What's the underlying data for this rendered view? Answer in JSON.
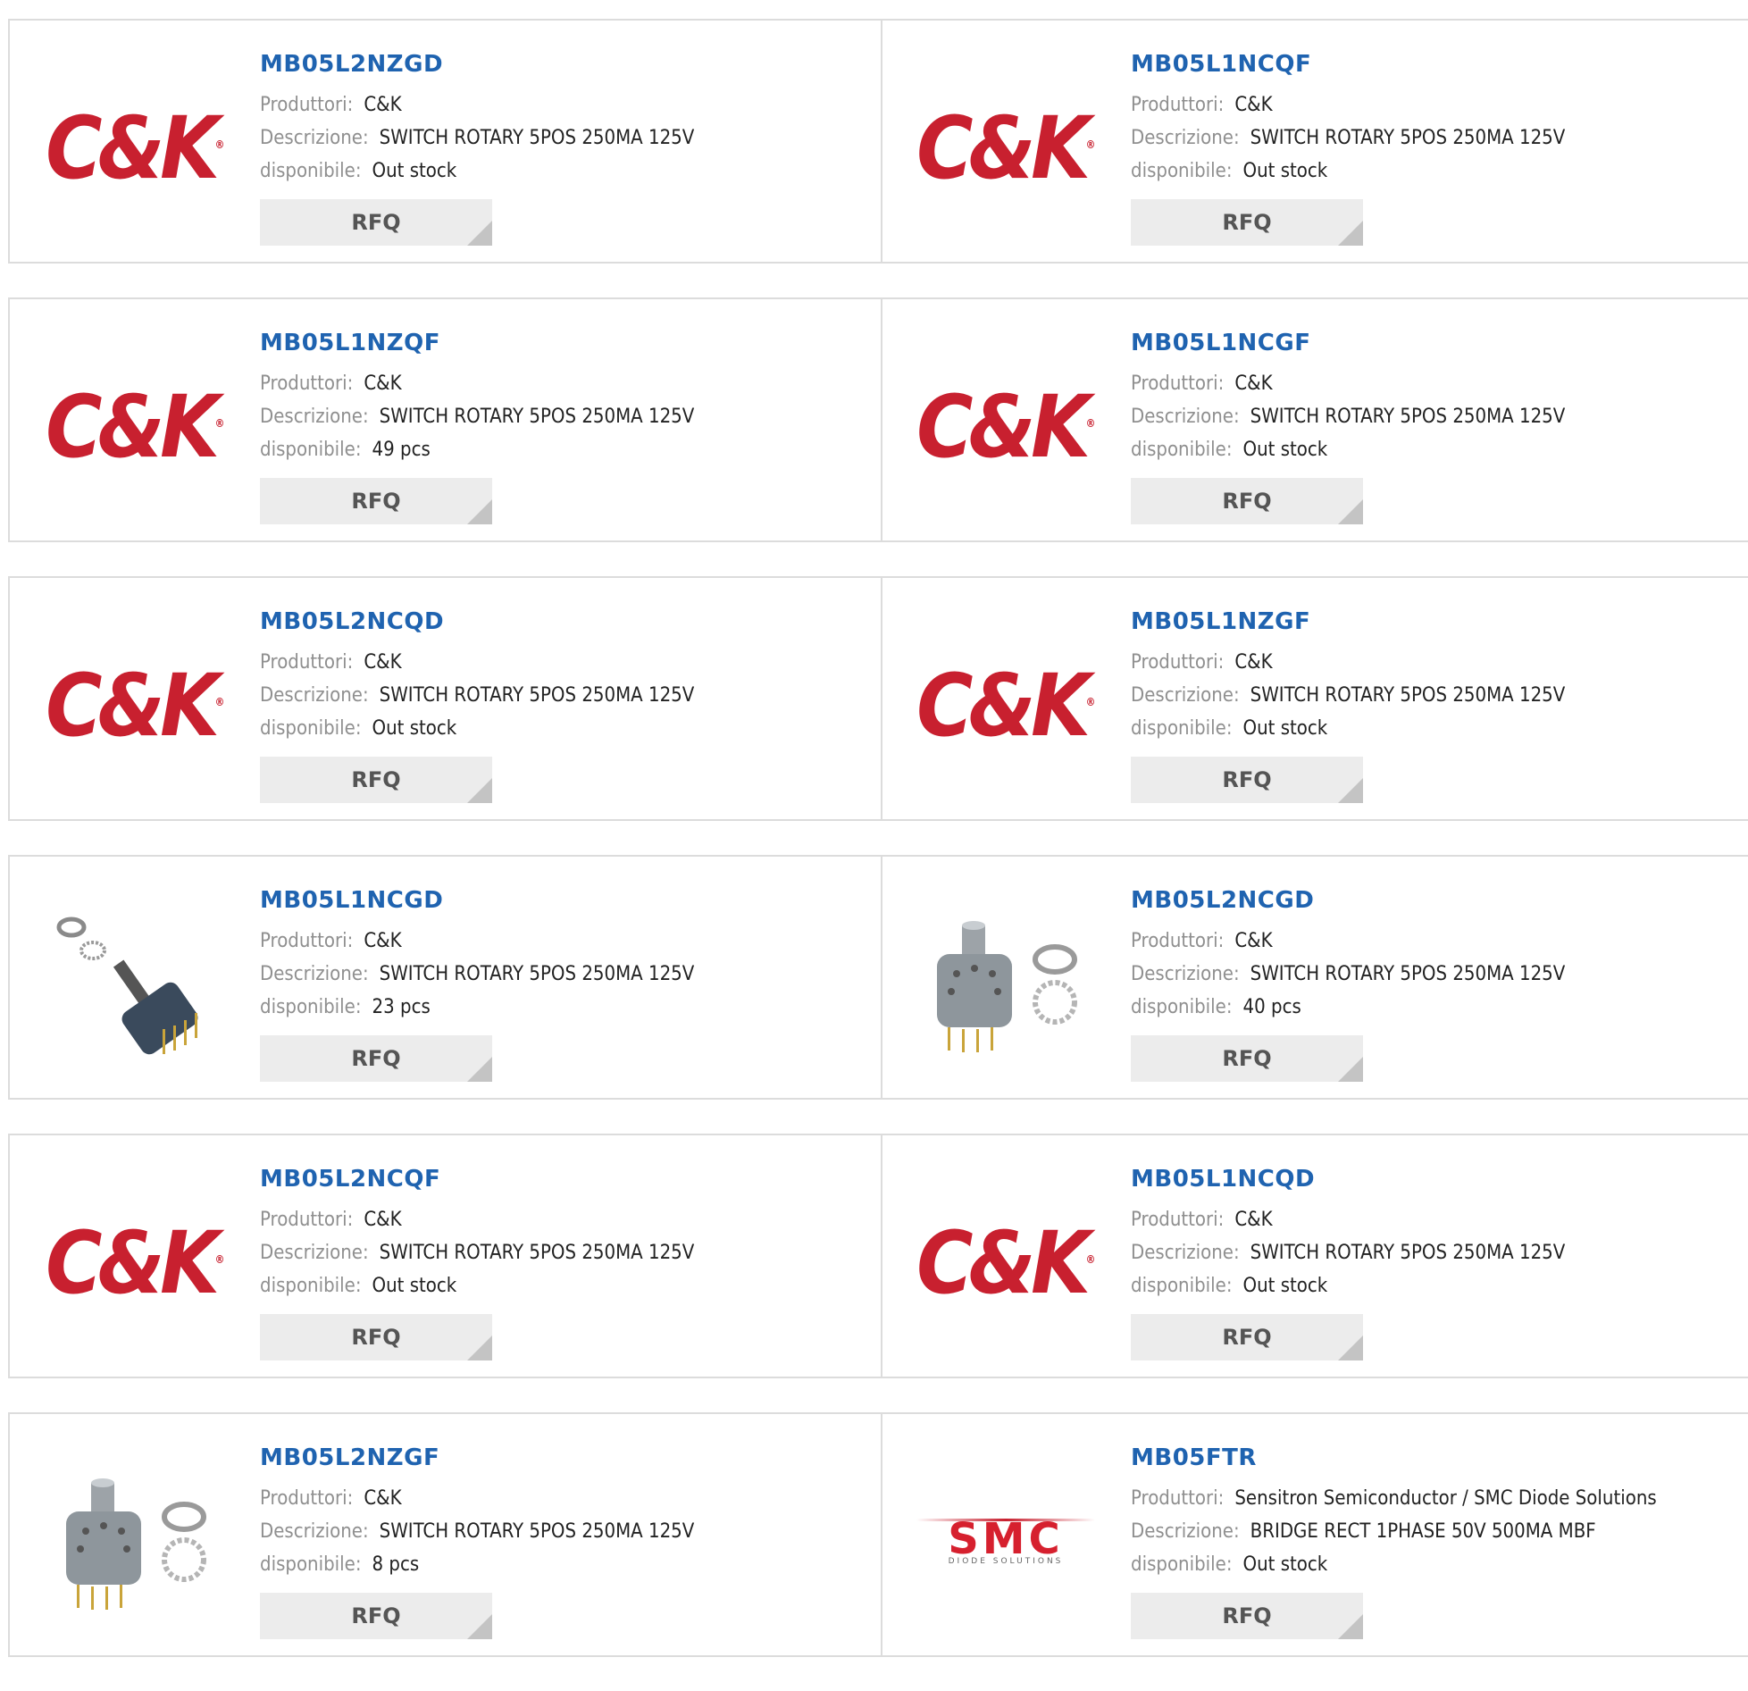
{
  "labels": {
    "manufacturer": "Produttori:",
    "description": "Descrizione:",
    "availability": "disponibile:",
    "rfq": "RFQ"
  },
  "products": [
    {
      "part": "MB05L2NZGD",
      "manufacturer": "C&K",
      "description": "SWITCH ROTARY 5POS 250MA 125V",
      "availability": "Out stock",
      "image": "ck-logo"
    },
    {
      "part": "MB05L1NCQF",
      "manufacturer": "C&K",
      "description": "SWITCH ROTARY 5POS 250MA 125V",
      "availability": "Out stock",
      "image": "ck-logo"
    },
    {
      "part": "MB05L1NZQF",
      "manufacturer": "C&K",
      "description": "SWITCH ROTARY 5POS 250MA 125V",
      "availability": "49 pcs",
      "image": "ck-logo"
    },
    {
      "part": "MB05L1NCGF",
      "manufacturer": "C&K",
      "description": "SWITCH ROTARY 5POS 250MA 125V",
      "availability": "Out stock",
      "image": "ck-logo"
    },
    {
      "part": "MB05L2NCQD",
      "manufacturer": "C&K",
      "description": "SWITCH ROTARY 5POS 250MA 125V",
      "availability": "Out stock",
      "image": "ck-logo"
    },
    {
      "part": "MB05L1NZGF",
      "manufacturer": "C&K",
      "description": "SWITCH ROTARY 5POS 250MA 125V",
      "availability": "Out stock",
      "image": "ck-logo"
    },
    {
      "part": "MB05L1NCGD",
      "manufacturer": "C&K",
      "description": "SWITCH ROTARY 5POS 250MA 125V",
      "availability": "23 pcs",
      "image": "rotary-switch-photo-tilted"
    },
    {
      "part": "MB05L2NCGD",
      "manufacturer": "C&K",
      "description": "SWITCH ROTARY 5POS 250MA 125V",
      "availability": "40 pcs",
      "image": "rotary-switch-photo"
    },
    {
      "part": "MB05L2NCQF",
      "manufacturer": "C&K",
      "description": "SWITCH ROTARY 5POS 250MA 125V",
      "availability": "Out stock",
      "image": "ck-logo"
    },
    {
      "part": "MB05L1NCQD",
      "manufacturer": "C&K",
      "description": "SWITCH ROTARY 5POS 250MA 125V",
      "availability": "Out stock",
      "image": "ck-logo"
    },
    {
      "part": "MB05L2NZGF",
      "manufacturer": "C&K",
      "description": "SWITCH ROTARY 5POS 250MA 125V",
      "availability": "8 pcs",
      "image": "rotary-switch-photo"
    },
    {
      "part": "MB05FTR",
      "manufacturer": "Sensitron Semiconductor / SMC Diode Solutions",
      "description": "BRIDGE RECT 1PHASE 50V 500MA MBF",
      "availability": "Out stock",
      "image": "smc-logo"
    }
  ],
  "logos": {
    "ck": {
      "text": "C&K",
      "reg": "®"
    },
    "smc": {
      "text": "SMC",
      "sub": "DIODE SOLUTIONS"
    }
  },
  "colors": {
    "part_link": "#1f63b0",
    "ck_red": "#c8202f",
    "label_gray": "#8f8f8f",
    "border": "#dcdcdc",
    "button_bg": "#ececec"
  }
}
